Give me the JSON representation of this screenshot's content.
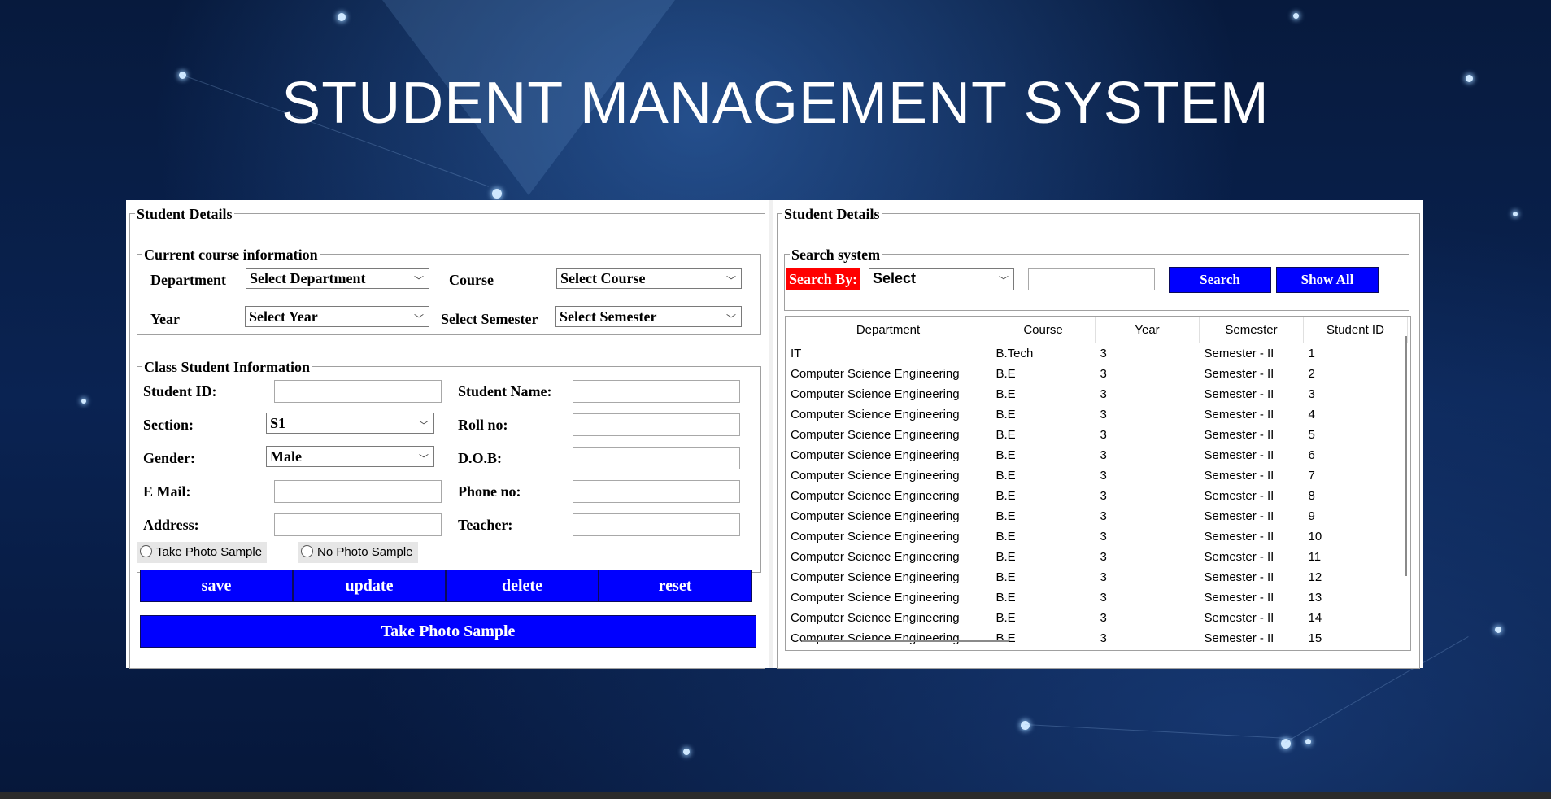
{
  "app_title": "STUDENT MANAGEMENT SYSTEM",
  "left": {
    "legend": "Student Details",
    "course": {
      "legend": "Current course information",
      "department_label": "Department",
      "department_value": "Select Department",
      "course_label": "Course",
      "course_value": "Select Course",
      "year_label": "Year",
      "year_value": "Select Year",
      "semester_label": "Select Semester",
      "semester_value": "Select Semester"
    },
    "class": {
      "legend": "Class Student Information",
      "student_id_label": "Student ID:",
      "student_id_value": "",
      "student_name_label": "Student Name:",
      "student_name_value": "",
      "section_label": "Section:",
      "section_value": "S1",
      "roll_label": "Roll no:",
      "roll_value": "",
      "gender_label": "Gender:",
      "gender_value": "Male",
      "dob_label": "D.O.B:",
      "dob_value": "",
      "email_label": "E Mail:",
      "email_value": "",
      "phone_label": "Phone no:",
      "phone_value": "",
      "address_label": "Address:",
      "address_value": "",
      "teacher_label": "Teacher:",
      "teacher_value": "",
      "radio_take": "Take Photo Sample",
      "radio_none": "No Photo Sample"
    },
    "buttons": {
      "save": "save",
      "update": "update",
      "delete": "delete",
      "reset": "reset",
      "take_photo": "Take Photo Sample"
    }
  },
  "right": {
    "legend": "Student Details",
    "search": {
      "legend": "Search system",
      "search_by_label": "Search By:",
      "search_by_value": "Select",
      "query_value": "",
      "search_button": "Search",
      "show_all_button": "Show All"
    },
    "table": {
      "columns": [
        "Department",
        "Course",
        "Year",
        "Semester",
        "Student ID"
      ],
      "rows": [
        [
          "IT",
          "B.Tech",
          "3",
          "Semester - II",
          "1"
        ],
        [
          "Computer Science Engineering",
          "B.E",
          "3",
          "Semester - II",
          "2"
        ],
        [
          "Computer Science Engineering",
          "B.E",
          "3",
          "Semester - II",
          "3"
        ],
        [
          "Computer Science Engineering",
          "B.E",
          "3",
          "Semester - II",
          "4"
        ],
        [
          "Computer Science Engineering",
          "B.E",
          "3",
          "Semester - II",
          "5"
        ],
        [
          "Computer Science Engineering",
          "B.E",
          "3",
          "Semester - II",
          "6"
        ],
        [
          "Computer Science Engineering",
          "B.E",
          "3",
          "Semester - II",
          "7"
        ],
        [
          "Computer Science Engineering",
          "B.E",
          "3",
          "Semester - II",
          "8"
        ],
        [
          "Computer Science Engineering",
          "B.E",
          "3",
          "Semester - II",
          "9"
        ],
        [
          "Computer Science Engineering",
          "B.E",
          "3",
          "Semester - II",
          "10"
        ],
        [
          "Computer Science Engineering",
          "B.E",
          "3",
          "Semester - II",
          "11"
        ],
        [
          "Computer Science Engineering",
          "B.E",
          "3",
          "Semester - II",
          "12"
        ],
        [
          "Computer Science Engineering",
          "B.E",
          "3",
          "Semester - II",
          "13"
        ],
        [
          "Computer Science Engineering",
          "B.E",
          "3",
          "Semester - II",
          "14"
        ],
        [
          "Computer Science Engineering",
          "B.E",
          "3",
          "Semester - II",
          "15"
        ]
      ]
    }
  },
  "colors": {
    "button_blue": "#0000ff",
    "search_by_red": "#ff0000"
  }
}
